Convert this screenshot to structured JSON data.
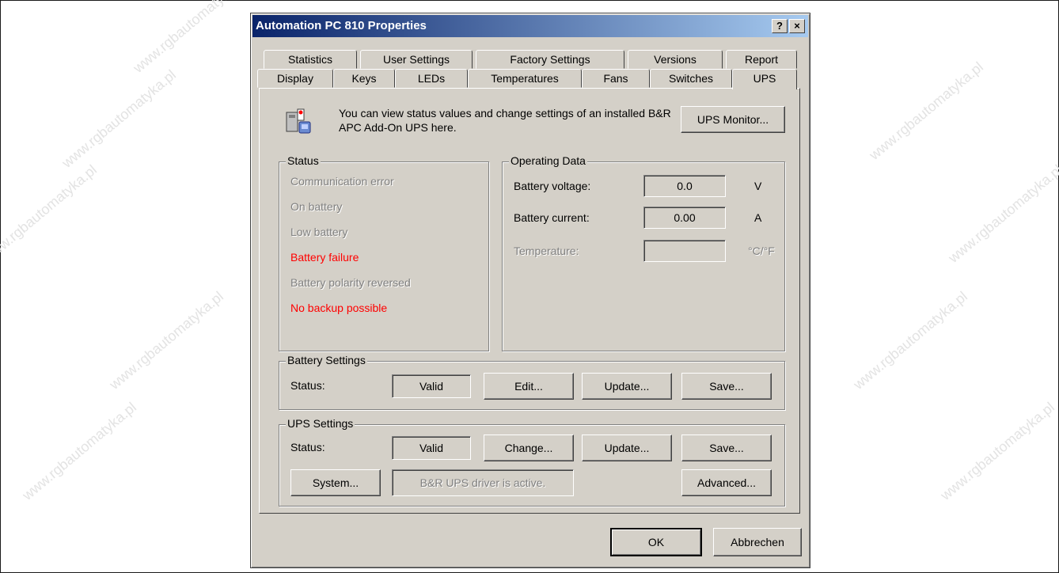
{
  "window": {
    "title": "Automation PC 810 Properties",
    "help_label": "?",
    "close_label": "×"
  },
  "tabs_back": [
    "Statistics",
    "User Settings",
    "Factory Settings",
    "Versions",
    "Report"
  ],
  "tabs_front": [
    "Display",
    "Keys",
    "LEDs",
    "Temperatures",
    "Fans",
    "Switches",
    "UPS"
  ],
  "active_tab": "UPS",
  "info": {
    "text": "You can view status values and change settings of an installed B&R APC Add-On UPS here.",
    "ups_monitor_button": "UPS Monitor..."
  },
  "status": {
    "title": "Status",
    "items": [
      {
        "label": "Communication error",
        "state": "disabled"
      },
      {
        "label": "On battery",
        "state": "disabled"
      },
      {
        "label": "Low battery",
        "state": "disabled"
      },
      {
        "label": "Battery failure",
        "state": "alert"
      },
      {
        "label": "Battery polarity reversed",
        "state": "disabled"
      },
      {
        "label": "No backup possible",
        "state": "alert"
      }
    ]
  },
  "operating": {
    "title": "Operating Data",
    "voltage_label": "Battery voltage:",
    "voltage_value": "0.0",
    "voltage_unit": "V",
    "current_label": "Battery current:",
    "current_value": "0.00",
    "current_unit": "A",
    "temp_label": "Temperature:",
    "temp_value": "",
    "temp_unit": "°C/°F"
  },
  "battery_settings": {
    "title": "Battery Settings",
    "status_label": "Status:",
    "status_value": "Valid",
    "edit_button": "Edit...",
    "update_button": "Update...",
    "save_button": "Save..."
  },
  "ups_settings": {
    "title": "UPS Settings",
    "status_label": "Status:",
    "status_value": "Valid",
    "change_button": "Change...",
    "update_button": "Update...",
    "save_button": "Save...",
    "system_button": "System...",
    "driver_status": "B&R UPS driver is active.",
    "advanced_button": "Advanced..."
  },
  "footer": {
    "ok_button": "OK",
    "cancel_button": "Abbrechen"
  },
  "watermark": "www.rgbautomatyka.pl",
  "colors": {
    "title_start": "#0a246a",
    "title_end": "#a6caf0",
    "face": "#d4d0c8",
    "alert": "#ff0000"
  }
}
